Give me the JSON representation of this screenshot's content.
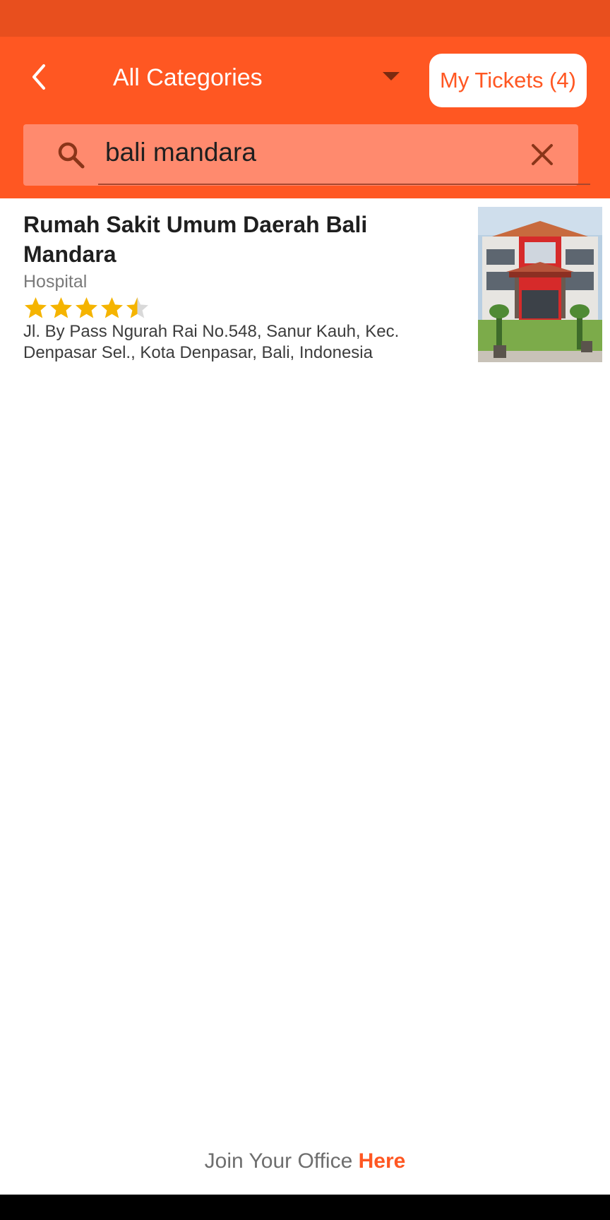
{
  "colors": {
    "status_bar": "#e84f1e",
    "header": "#ff5722",
    "search_bar": "#ff8a6e",
    "accent": "#ff5722",
    "star": "#f5b400",
    "star_empty": "#d9d9d9"
  },
  "header": {
    "back_icon": "chevron-left-icon",
    "category": "All Categories",
    "dropdown_icon": "caret-down-icon",
    "tickets_button": "My Tickets (4)"
  },
  "search": {
    "icon": "search-icon",
    "value": "bali mandara",
    "clear_icon": "close-icon"
  },
  "results": [
    {
      "title": "Rumah Sakit Umum Daerah Bali Mandara",
      "category": "Hospital",
      "rating": 4.5,
      "rating_max": 5,
      "address": "Jl. By Pass Ngurah Rai No.548, Sanur Kauh, Kec. Denpasar Sel., Kota Denpasar, Bali, Indonesia",
      "image": "hospital-building-photo"
    }
  ],
  "footer": {
    "text": "Join Your Office ",
    "link": "Here"
  }
}
